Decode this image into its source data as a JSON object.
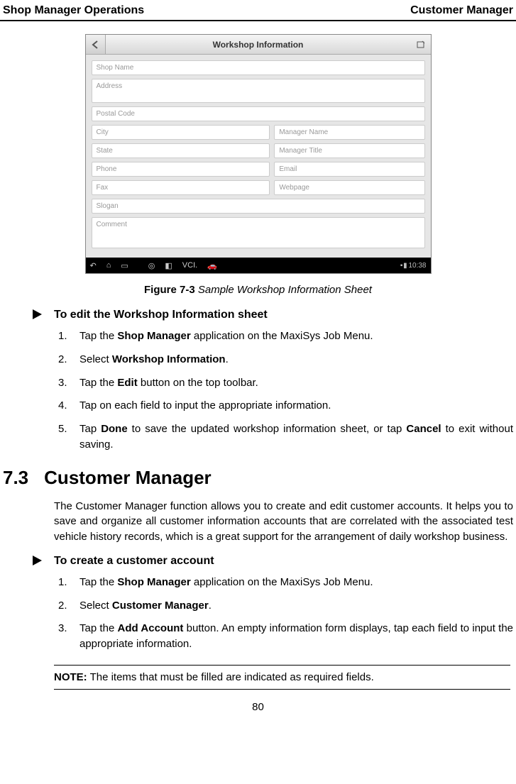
{
  "header": {
    "left": "Shop Manager Operations",
    "right": "Customer Manager"
  },
  "screenshot": {
    "title": "Workshop Information",
    "fields": {
      "shopName": "Shop Name",
      "address": "Address",
      "postalCode": "Postal Code",
      "city": "City",
      "state": "State",
      "phone": "Phone",
      "fax": "Fax",
      "managerName": "Manager Name",
      "managerTitle": "Manager Title",
      "email": "Email",
      "webpage": "Webpage",
      "slogan": "Slogan",
      "comment": "Comment"
    },
    "time": "10:38"
  },
  "figure": {
    "label": "Figure 7-3",
    "title": " Sample Workshop Information Sheet"
  },
  "proc1": {
    "title": "To edit the Workshop Information sheet",
    "step1_a": "Tap the ",
    "step1_b": "Shop Manager",
    "step1_c": " application on the MaxiSys Job Menu.",
    "step2_a": "Select ",
    "step2_b": "Workshop Information",
    "step2_c": ".",
    "step3_a": "Tap the ",
    "step3_b": "Edit",
    "step3_c": " button on the top toolbar.",
    "step4": "Tap on each field to input the appropriate information.",
    "step5_a": "Tap ",
    "step5_b": "Done",
    "step5_c": " to save the updated workshop information sheet, or tap ",
    "step5_d": "Cancel",
    "step5_e": " to exit without saving."
  },
  "section": {
    "num": "7.3",
    "title": "Customer Manager",
    "para": "The Customer Manager function allows you to create and edit customer accounts. It helps you to save and organize all customer information accounts that are correlated with the associated test vehicle history records, which is a great support for the arrangement of daily workshop business."
  },
  "proc2": {
    "title": "To create a customer account",
    "step1_a": "Tap the ",
    "step1_b": "Shop Manager",
    "step1_c": " application on the MaxiSys Job Menu.",
    "step2_a": "Select ",
    "step2_b": "Customer Manager",
    "step2_c": ".",
    "step3_a": "Tap the ",
    "step3_b": "Add Account",
    "step3_c": " button. An empty information form displays, tap each field to input the appropriate information."
  },
  "note": {
    "label": "NOTE:",
    "text": " The items that must be filled are indicated as required fields."
  },
  "pageNumber": "80"
}
